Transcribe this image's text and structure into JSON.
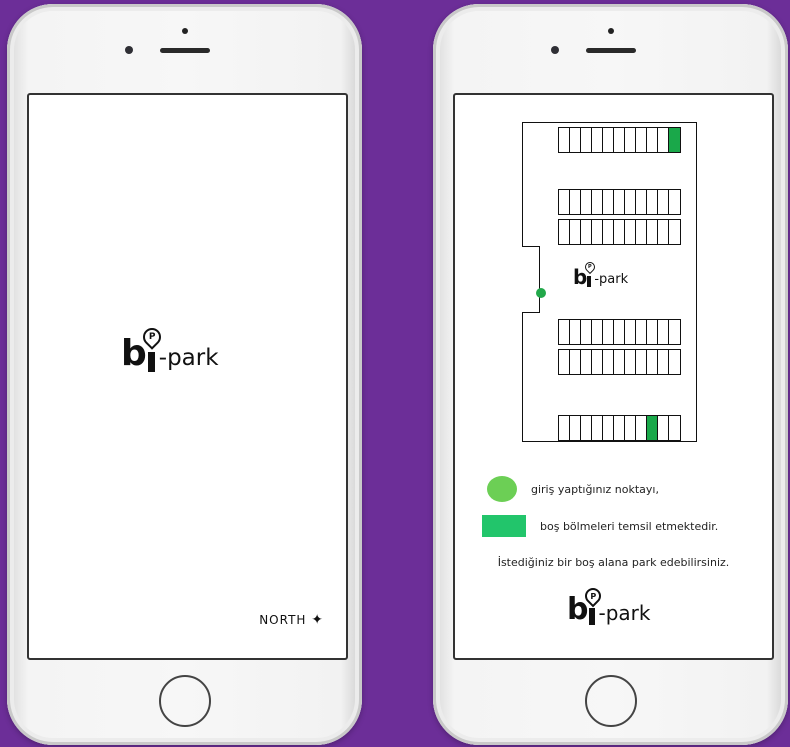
{
  "left_screen": {
    "logo": {
      "b": "b",
      "i": "i",
      "pin_letter": "P",
      "rest": "-park"
    },
    "footer_brand": "NORTH",
    "footer_glyph": "✦"
  },
  "right_screen": {
    "map_logo": {
      "b": "b",
      "i": "i",
      "pin_letter": "P",
      "rest": "-park"
    },
    "legend": {
      "entry_text": "giriş yaptığınız noktayı,",
      "free_text": "boş bölmeleri temsil etmektedir.",
      "note": "İstediğiniz bir boş alana park edebilirsiniz."
    },
    "bottom_logo": {
      "b": "b",
      "i": "i",
      "pin_letter": "P",
      "rest": "-park"
    }
  },
  "colors": {
    "background": "#6c2e98",
    "free_slot": "#1aa84a",
    "entry_dot": "#22a84a",
    "legend_circle": "#6ccf55",
    "legend_rect": "#22c56b"
  },
  "parking_rows": [
    {
      "slots": 11,
      "free": [
        10
      ]
    },
    {
      "slots": 11,
      "free": []
    },
    {
      "slots": 11,
      "free": []
    },
    {
      "slots": 11,
      "free": []
    },
    {
      "slots": 11,
      "free": []
    },
    {
      "slots": 11,
      "free": [
        8
      ]
    }
  ]
}
